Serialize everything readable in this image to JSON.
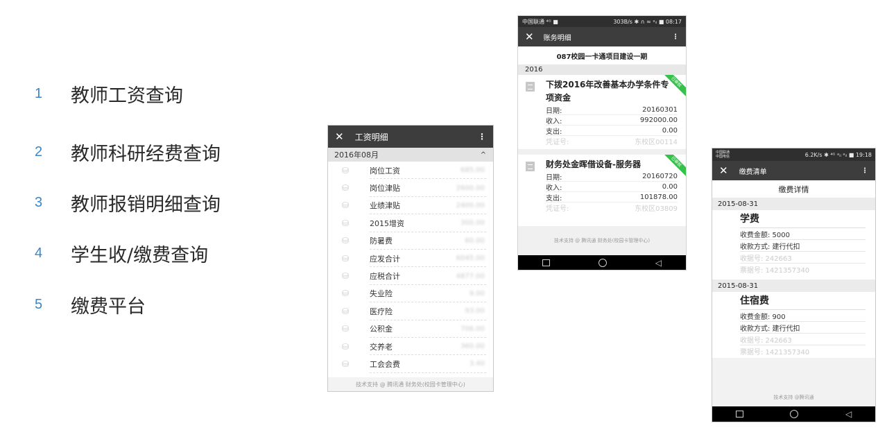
{
  "features": [
    {
      "num": "1",
      "label": "教师工资查询"
    },
    {
      "num": "2",
      "label": "教师科研经费查询"
    },
    {
      "num": "3",
      "label": "教师报销明细查询"
    },
    {
      "num": "4",
      "label": "学生收/缴费查询"
    },
    {
      "num": "5",
      "label": "缴费平台"
    }
  ],
  "salary_phone": {
    "close": "✕",
    "title": "工资明细",
    "menu": "⋮",
    "month": "2016年08月",
    "collapse": "^",
    "rows": [
      {
        "label": "岗位工资",
        "value": "685.00"
      },
      {
        "label": "岗位津贴",
        "value": "2600.00"
      },
      {
        "label": "业绩津贴",
        "value": "2400.00"
      },
      {
        "label": "2015增资",
        "value": "300.00"
      },
      {
        "label": "防暑费",
        "value": "60.00"
      },
      {
        "label": "应发合计",
        "value": "6045.00"
      },
      {
        "label": "应税合计",
        "value": "4877.00"
      },
      {
        "label": "失业险",
        "value": "9.00"
      },
      {
        "label": "医疗险",
        "value": "93.00"
      },
      {
        "label": "公积金",
        "value": "706.00"
      },
      {
        "label": "交养老",
        "value": "360.00"
      },
      {
        "label": "工会会费",
        "value": "3.40"
      }
    ],
    "footer": "技术支持 @ 腾讯通 财务处(校园卡管理中心)"
  },
  "accounts_phone": {
    "status_left": "中国联通 ⁴ᴳ ■",
    "status_right": "303B/s ✱ ∩ ≈ ᵃᵢₗ ■ 08:17",
    "close": "✕",
    "title": "账务明细",
    "menu": "⋮",
    "project": "087校园一卡通项目建设一期",
    "year": "2016",
    "entries": [
      {
        "title": "下拨2016年改善基本办学条件专项资金",
        "ribbon": "已审核",
        "date_label": "日期:",
        "date": "20160301",
        "income_label": "收入:",
        "income": "992000.00",
        "expense_label": "支出:",
        "expense": "0.00",
        "voucher_label": "凭证号:",
        "voucher": "东校区00114"
      },
      {
        "title": "财务处金晖借设备-服务器",
        "ribbon": "已审核",
        "date_label": "日期:",
        "date": "20160720",
        "income_label": "收入:",
        "income": "0.00",
        "expense_label": "支出:",
        "expense": "101878.00",
        "voucher_label": "凭证号:",
        "voucher": "东校区03809"
      }
    ],
    "footer": "技术支持 @ 腾讯通 财务处(校园卡管理中心)",
    "nav_back": "◁"
  },
  "fees_phone": {
    "status_left": "中国联通\n中国电信",
    "status_right": "6.2K/s ✱ ⁴ᴳ ᵃᵢₗ ᵃᵢₗ ■ 19:18",
    "close": "✕",
    "title": "缴费清单",
    "menu": "⋮",
    "heading": "缴费详情",
    "records": [
      {
        "date": "2015-08-31",
        "title": "学费",
        "amount": "收费金额: 5000",
        "method": "收款方式: 建行代扣",
        "receipt": "收据号: 242663",
        "invoice": "票据号: 1421357340"
      },
      {
        "date": "2015-08-31",
        "title": "住宿费",
        "amount": "收费金额: 900",
        "method": "收款方式: 建行代扣",
        "receipt": "收据号: 242663",
        "invoice": "票据号: 1421357340"
      }
    ],
    "footer": "技术支持 @腾讯通",
    "nav_back": "◁"
  }
}
